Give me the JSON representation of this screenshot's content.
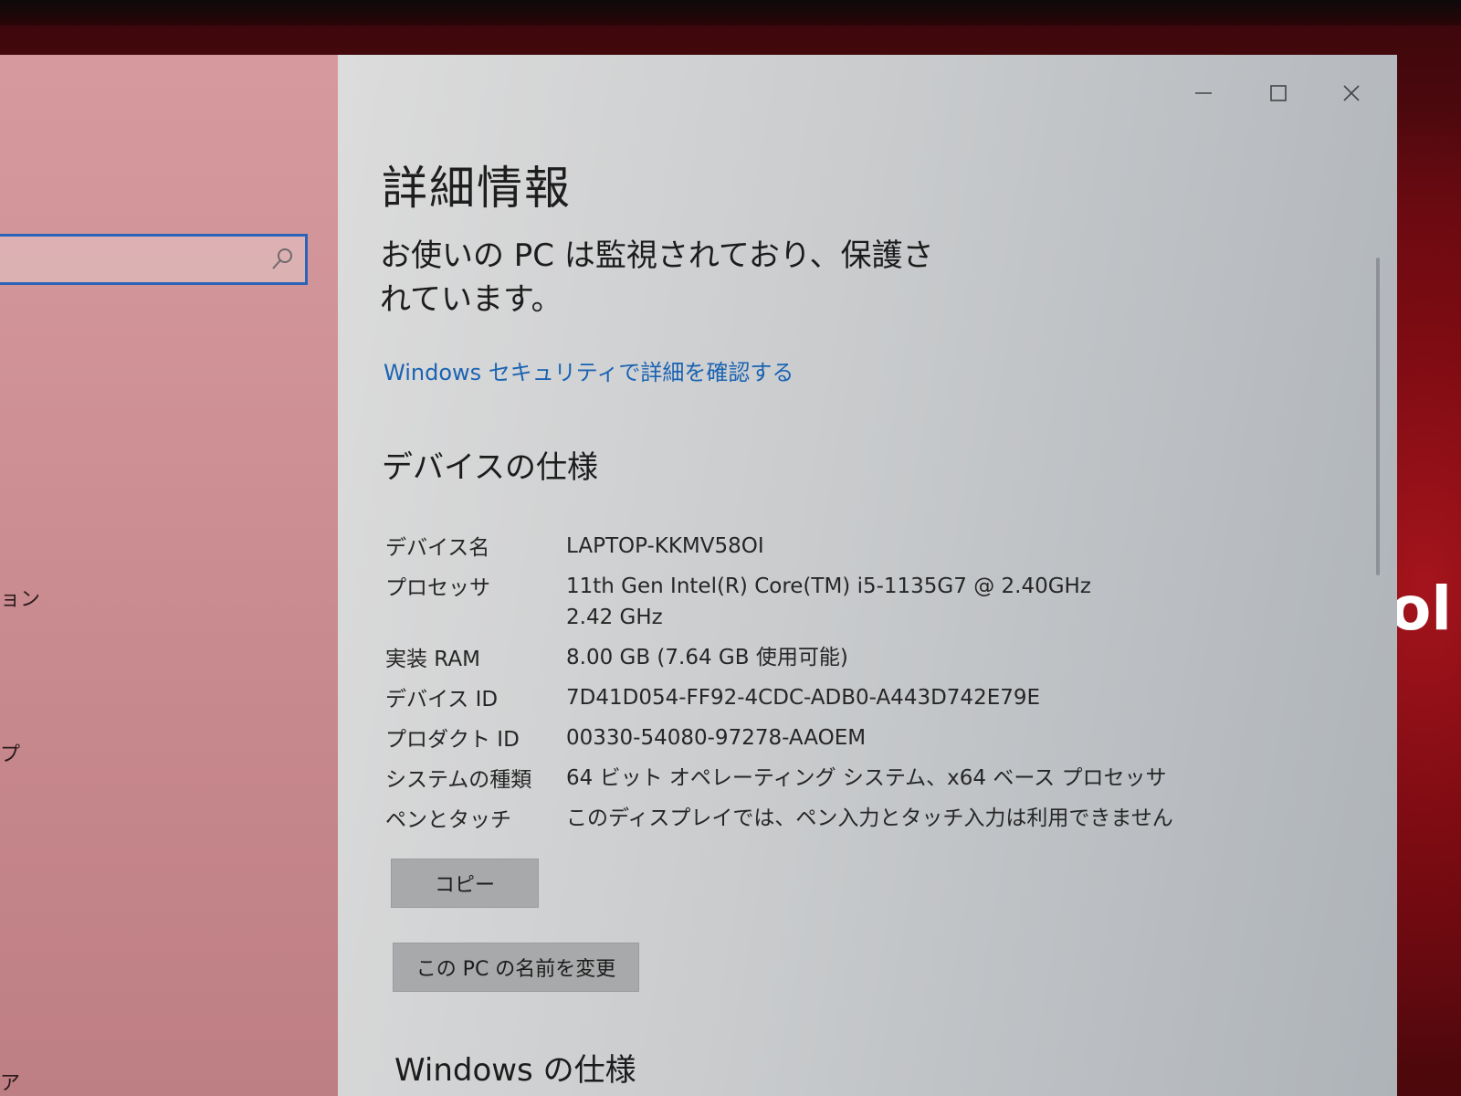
{
  "window": {
    "title": "詳細情報",
    "controls": {
      "minimize": "—",
      "maximize": "☐",
      "close": "✕"
    }
  },
  "nav": {
    "items": [
      {
        "label": "ョン"
      },
      {
        "label": "プ"
      },
      {
        "label": "ア"
      }
    ]
  },
  "desktop": {
    "brand_fragment": "ol"
  },
  "security": {
    "status": "お使いの PC は監視されており、保護されています。",
    "link": "Windows セキュリティで詳細を確認する"
  },
  "device_specs": {
    "heading": "デバイスの仕様",
    "rows": [
      {
        "label": "デバイス名",
        "value": "LAPTOP-KKMV58OI"
      },
      {
        "label": "プロセッサ",
        "value": "11th Gen Intel(R) Core(TM) i5-1135G7 @ 2.40GHz",
        "value2": "2.42 GHz"
      },
      {
        "label": "実装 RAM",
        "value": "8.00 GB (7.64 GB 使用可能)"
      },
      {
        "label": "デバイス ID",
        "value": "7D41D054-FF92-4CDC-ADB0-A443D742E79E"
      },
      {
        "label": "プロダクト ID",
        "value": "00330-54080-97278-AAOEM"
      },
      {
        "label": "システムの種類",
        "value": "64 ビット オペレーティング システム、x64 ベース プロセッサ"
      },
      {
        "label": "ペンとタッチ",
        "value": "このディスプレイでは、ペン入力とタッチ入力は利用できません"
      }
    ],
    "copy_button": "コピー",
    "rename_button": "この PC の名前を変更"
  },
  "windows_specs": {
    "heading": "Windows の仕様"
  },
  "colors": {
    "accent_link": "#1a63b3",
    "search_border": "#2b63b8",
    "wallpaper": "#6b0b12"
  }
}
